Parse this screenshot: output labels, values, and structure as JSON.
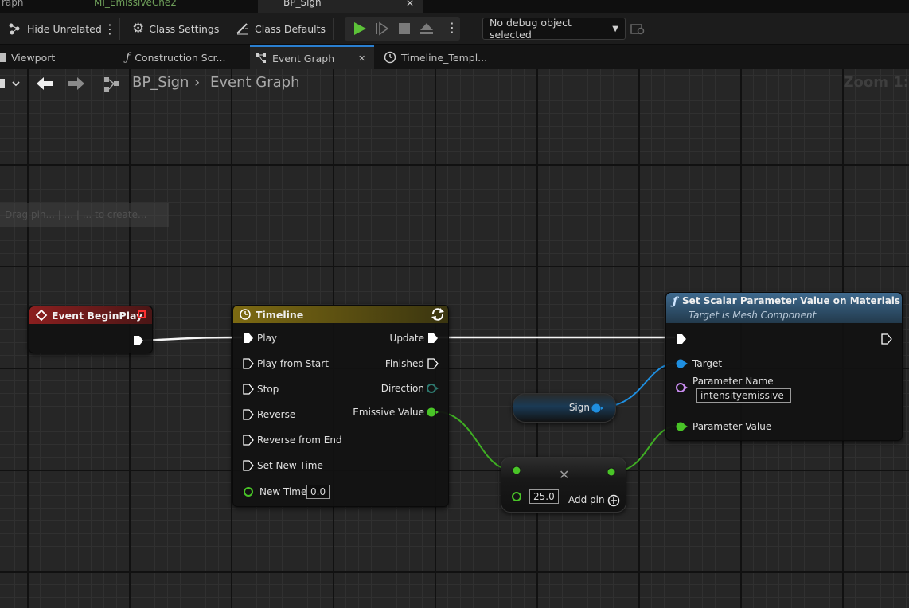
{
  "asset_tabs": [
    {
      "label": "raph"
    },
    {
      "label": "MI_EmissiveChe2"
    },
    {
      "label": "BP_Sign"
    }
  ],
  "toolbar": {
    "hide_unrelated": "Hide Unrelated",
    "class_settings": "Class Settings",
    "class_defaults": "Class Defaults",
    "debug_object": "No debug object selected"
  },
  "doc_tabs": [
    {
      "label": "Viewport",
      "icon": "viewport-icon"
    },
    {
      "label": "Construction Scr...",
      "icon": "function-icon"
    },
    {
      "label": "Event Graph",
      "icon": "graph-icon",
      "active": true
    },
    {
      "label": "Timeline_Templ...",
      "icon": "clock-icon"
    }
  ],
  "breadcrumb": {
    "blueprint": "BP_Sign",
    "graph": "Event Graph"
  },
  "zoom": "Zoom 1:",
  "comment": "Drag pin... | ... | ... to create...",
  "nodes": {
    "begin_play": {
      "title": "Event BeginPlay",
      "color": "#7a1e1e"
    },
    "timeline": {
      "title": "Timeline",
      "color": "#7a6a14",
      "inputs": [
        "Play",
        "Play from Start",
        "Stop",
        "Reverse",
        "Reverse from End",
        "Set New Time",
        "New Time"
      ],
      "new_time_value": "0.0",
      "outputs": [
        "Update",
        "Finished",
        "Direction",
        "Emissive Value"
      ]
    },
    "set_scalar": {
      "title": "Set Scalar Parameter Value on Materials",
      "subtitle": "Target is Mesh Component",
      "color": "#3a5d7a",
      "target_label": "Target",
      "param_name_label": "Parameter Name",
      "param_name_value": "intensityemissive",
      "param_value_label": "Parameter Value"
    },
    "sign": {
      "label": "Sign"
    },
    "multiply": {
      "value": "25.0",
      "add_pin": "Add pin"
    }
  },
  "colors": {
    "exec": "#ffffff",
    "float": "#49c427",
    "object": "#1f8fe0",
    "name": "#c98cf0",
    "struct": "#2e7a70"
  }
}
